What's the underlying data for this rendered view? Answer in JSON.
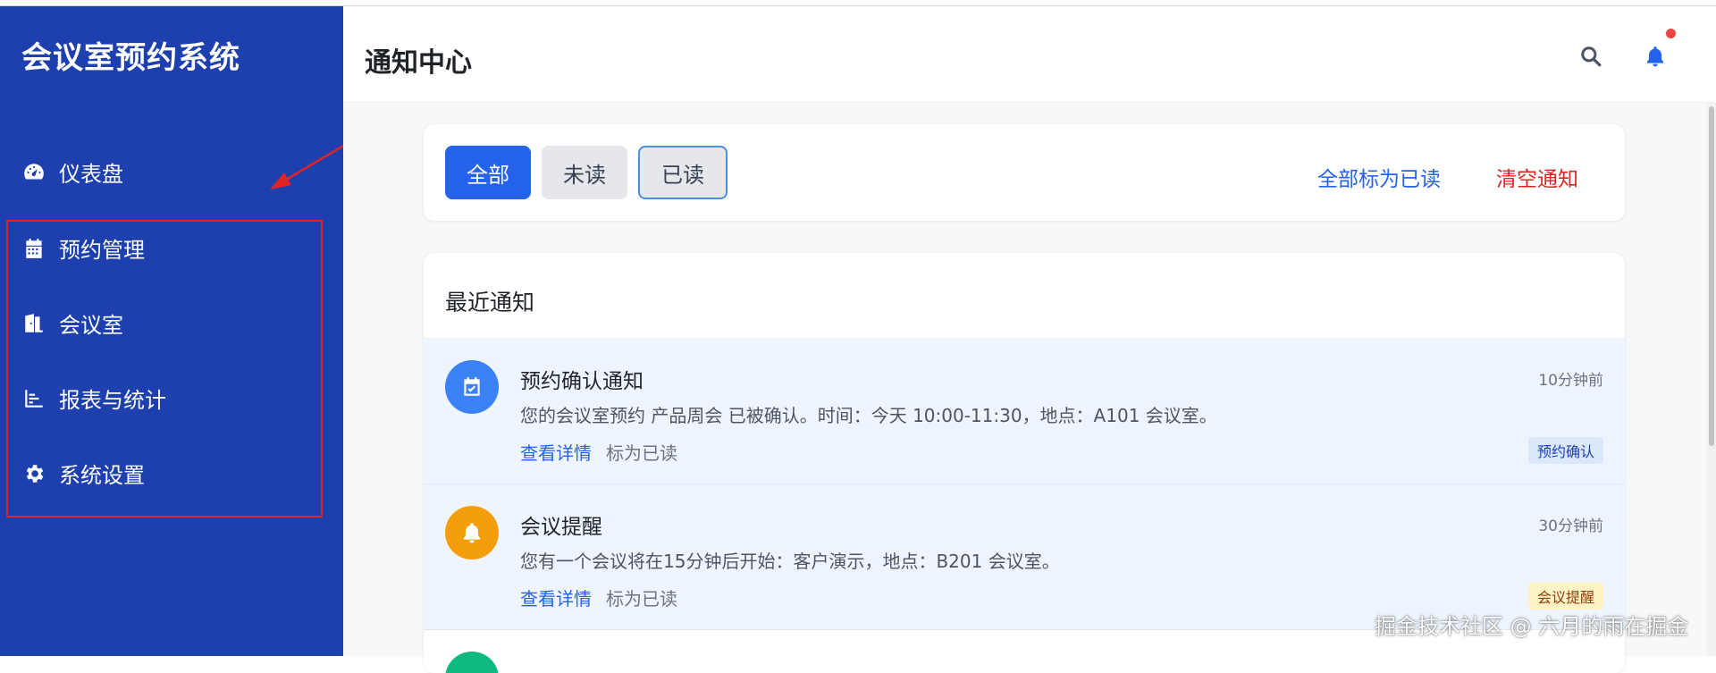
{
  "app": {
    "brand": "会议室预约系统"
  },
  "sidebar": {
    "items": [
      {
        "label": "仪表盘",
        "icon": "dashboard-icon"
      },
      {
        "label": "预约管理",
        "icon": "calendar-icon"
      },
      {
        "label": "会议室",
        "icon": "door-icon"
      },
      {
        "label": "报表与统计",
        "icon": "bar-chart-icon"
      },
      {
        "label": "系统设置",
        "icon": "gear-icon"
      }
    ]
  },
  "header": {
    "title": "通知中心"
  },
  "filters": {
    "all": "全部",
    "unread": "未读",
    "read": "已读",
    "mark_all_read": "全部标为已读",
    "clear": "清空通知"
  },
  "list": {
    "title": "最近通知",
    "notifications": [
      {
        "title": "预约确认通知",
        "time": "10分钟前",
        "body": "您的会议室预约 产品周会 已被确认。时间：今天 10:00-11:30，地点：A101 会议室。",
        "view": "查看详情",
        "mark": "标为已读",
        "badge": "预约确认",
        "color": "#3b82f6",
        "icon": "calendar-check-icon"
      },
      {
        "title": "会议提醒",
        "time": "30分钟前",
        "body": "您有一个会议将在15分钟后开始：客户演示，地点：B201 会议室。",
        "view": "查看详情",
        "mark": "标为已读",
        "badge": "会议提醒",
        "color": "#f59e0b",
        "icon": "bell-icon"
      }
    ]
  },
  "colors": {
    "sidebar": "#1e3fae",
    "primary": "#2563eb",
    "danger": "#dc2626",
    "annotation": "#e02424"
  },
  "watermark": "掘金技术社区 @ 六月的雨在掘金"
}
